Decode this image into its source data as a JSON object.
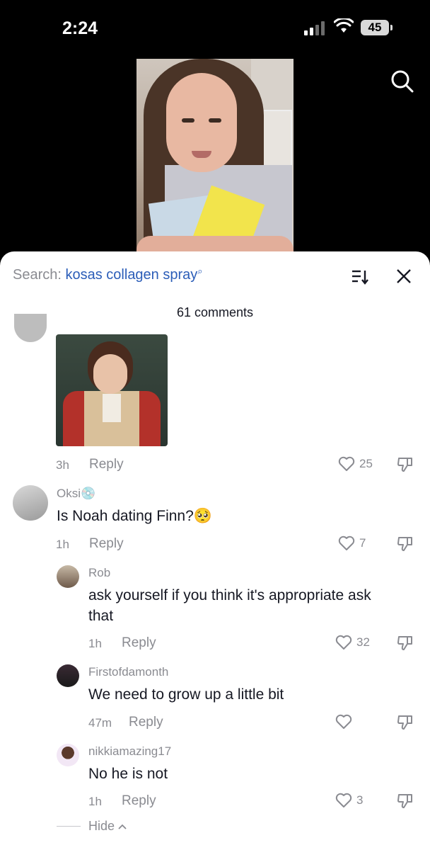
{
  "status_bar": {
    "time": "2:24",
    "battery": "45"
  },
  "sheet": {
    "search_prefix": "Search:",
    "search_query": "kosas collagen spray",
    "comment_count": "61 comments"
  },
  "comments": [
    {
      "time": "3h",
      "reply": "Reply",
      "likes": "25"
    },
    {
      "name": "Oksi",
      "name_emoji": "💿",
      "text": "Is Noah dating Finn?",
      "text_emoji": "🥺",
      "time": "1h",
      "reply": "Reply",
      "likes": "7"
    },
    {
      "name": "Rob",
      "text_line1": "ask yourself if you think it's appropriate ask",
      "text_line2": "that",
      "time": "1h",
      "reply": "Reply",
      "likes": "32"
    },
    {
      "name": "Firstofdamonth",
      "text": "We need to grow up a little bit",
      "time": "47m",
      "reply": "Reply",
      "likes": ""
    },
    {
      "name": "nikkiamazing17",
      "text": "No he is not",
      "time": "1h",
      "reply": "Reply",
      "likes": "3"
    }
  ],
  "hide_label": "Hide",
  "icons": {
    "search": "search-icon",
    "sort": "sort-icon",
    "close": "close-icon",
    "like": "heart-icon",
    "dislike": "thumbs-down-icon"
  },
  "colors": {
    "search_query": "#2b5db8",
    "muted": "#8a8b91",
    "text": "#161823"
  }
}
